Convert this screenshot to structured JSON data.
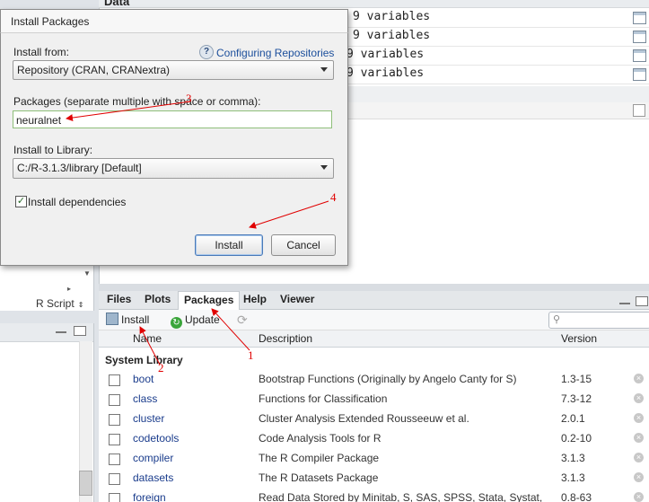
{
  "environment": {
    "header": "Data",
    "rows": [
      "9 variables",
      "9 variables",
      "9 variables",
      "9 variables"
    ]
  },
  "left_pane": {
    "script_selector": "R Script",
    "scroll_right": "▸"
  },
  "packages_pane": {
    "tabs": [
      {
        "label": "Files"
      },
      {
        "label": "Plots"
      },
      {
        "label": "Packages"
      },
      {
        "label": "Help"
      },
      {
        "label": "Viewer"
      }
    ],
    "toolbar": {
      "install": "Install",
      "update": "Update"
    },
    "columns": {
      "name": "Name",
      "description": "Description",
      "version": "Version"
    },
    "group": "System Library",
    "rows": [
      {
        "name": "boot",
        "description": "Bootstrap Functions (Originally by Angelo Canty for S)",
        "version": "1.3-15"
      },
      {
        "name": "class",
        "description": "Functions for Classification",
        "version": "7.3-12"
      },
      {
        "name": "cluster",
        "description": "Cluster Analysis Extended Rousseeuw et al.",
        "version": "2.0.1"
      },
      {
        "name": "codetools",
        "description": "Code Analysis Tools for R",
        "version": "0.2-10"
      },
      {
        "name": "compiler",
        "description": "The R Compiler Package",
        "version": "3.1.3"
      },
      {
        "name": "datasets",
        "description": "The R Datasets Package",
        "version": "3.1.3"
      },
      {
        "name": "foreign",
        "description": "Read Data Stored by Minitab, S, SAS, SPSS, Stata, Systat,",
        "version": "0.8-63"
      }
    ]
  },
  "dialog": {
    "title": "Install Packages",
    "install_from_label": "Install from:",
    "help_link": "Configuring Repositories",
    "repository": "Repository (CRAN, CRANextra)",
    "packages_label": "Packages (separate multiple with space or comma):",
    "packages_value": "neuralnet",
    "library_label": "Install to Library:",
    "library_value": "C:/R-3.1.3/library [Default]",
    "dependencies_label": "Install dependencies",
    "dependencies_checked": true,
    "install_button": "Install",
    "cancel_button": "Cancel"
  },
  "annotations": [
    "1",
    "2",
    "3",
    "4"
  ],
  "colors": {
    "annotation": "#e00000",
    "link": "#1c4f9c"
  }
}
